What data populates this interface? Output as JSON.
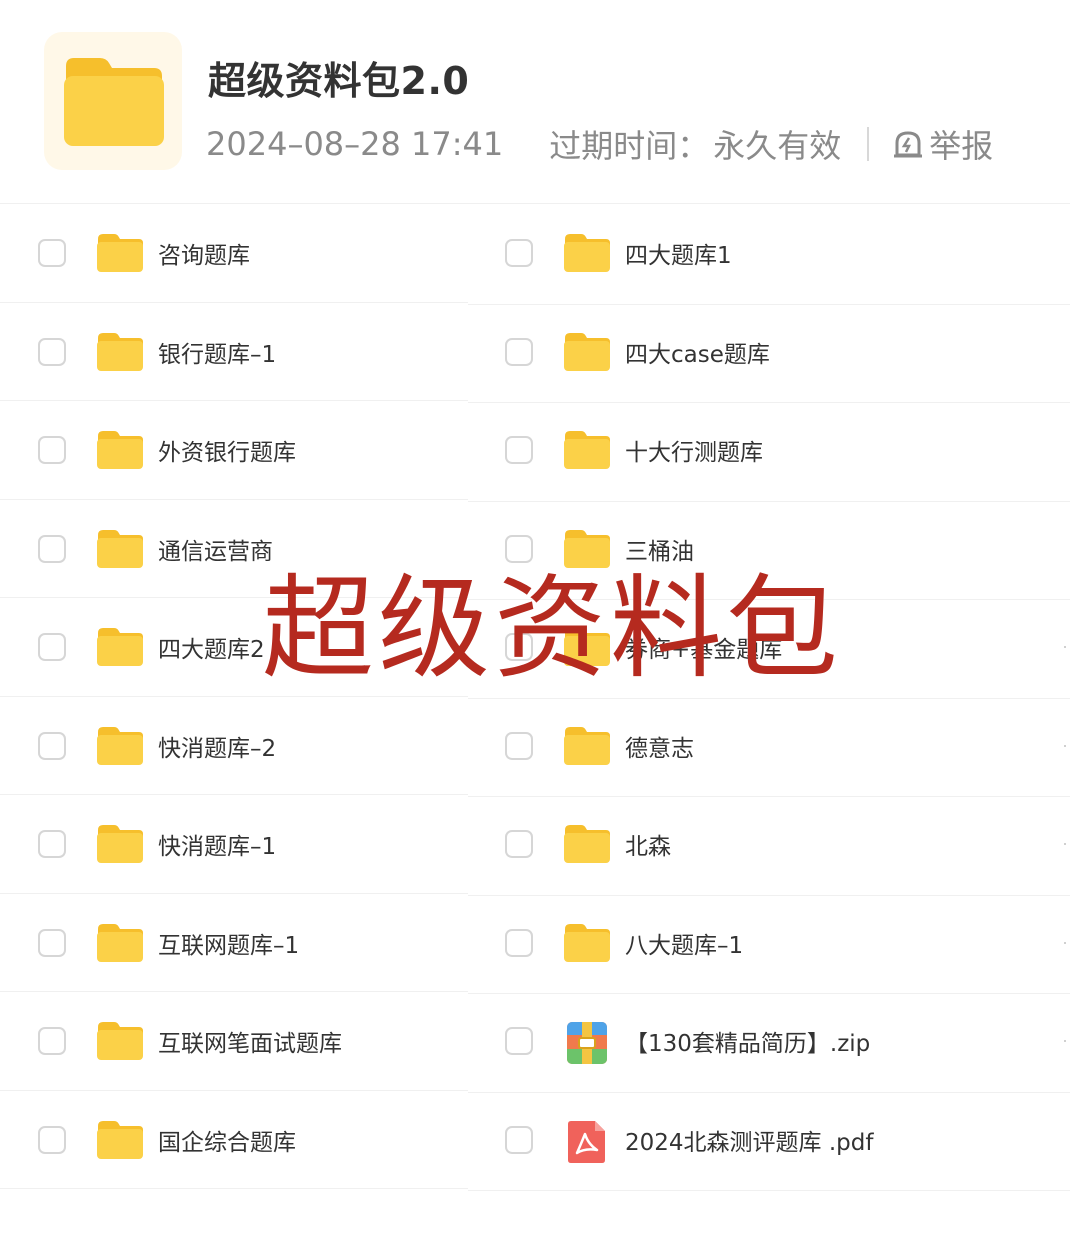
{
  "header": {
    "title": "超级资料包2.0",
    "date": "2024–08–28 17:41",
    "expire_label": "过期时间：",
    "expire_value": "永久有效",
    "report_label": "举报",
    "folder_icon": "folder-icon",
    "report_icon": "report-icon"
  },
  "left_items": [
    {
      "name": "咨询题库",
      "icon": "folder-icon"
    },
    {
      "name": "银行题库–1",
      "icon": "folder-icon"
    },
    {
      "name": "外资银行题库",
      "icon": "folder-icon"
    },
    {
      "name": "通信运营商",
      "icon": "folder-icon"
    },
    {
      "name": "四大题库2",
      "icon": "folder-icon"
    },
    {
      "name": "快消题库–2",
      "icon": "folder-icon"
    },
    {
      "name": "快消题库–1",
      "icon": "folder-icon"
    },
    {
      "name": "互联网题库–1",
      "icon": "folder-icon"
    },
    {
      "name": "互联网笔面试题库",
      "icon": "folder-icon"
    },
    {
      "name": "国企综合题库",
      "icon": "folder-icon"
    }
  ],
  "right_items": [
    {
      "name": "四大题库1",
      "icon": "folder-icon"
    },
    {
      "name": "四大case题库",
      "icon": "folder-icon"
    },
    {
      "name": "十大行测题库",
      "icon": "folder-icon"
    },
    {
      "name": "三桶油",
      "icon": "folder-icon"
    },
    {
      "name": "券商+基金题库",
      "icon": "folder-icon"
    },
    {
      "name": "德意志",
      "icon": "folder-icon"
    },
    {
      "name": "北森",
      "icon": "folder-icon"
    },
    {
      "name": "八大题库–1",
      "icon": "folder-icon"
    },
    {
      "name": "【130套精品简历】.zip",
      "icon": "zip-archive-icon"
    },
    {
      "name": "2024北森测评题库 .pdf",
      "icon": "pdf-file-icon"
    }
  ],
  "watermark": "超级资料包",
  "colors": {
    "folder_yellow": "#fbd148",
    "folder_tab": "#f6bf2c",
    "watermark_red": "#b52a1f",
    "meta_gray": "#8a8a8a",
    "pdf_red": "#f0625b"
  }
}
